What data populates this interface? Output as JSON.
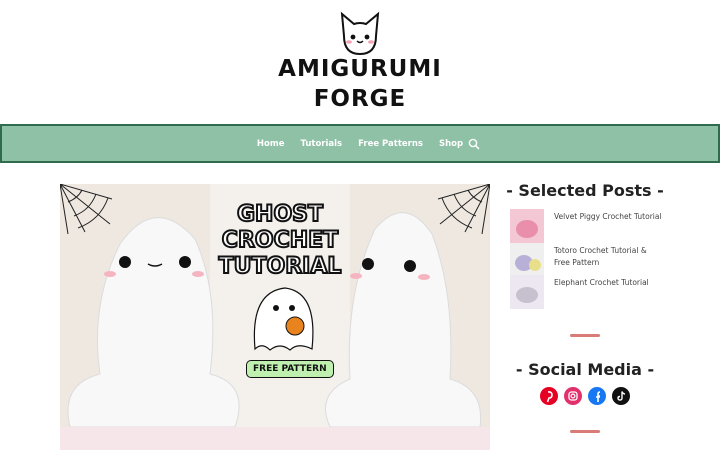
{
  "site": {
    "logo_line1": "AMIGURUMI",
    "logo_line2": "FORGE"
  },
  "nav": {
    "items": [
      "Home",
      "Tutorials",
      "Free Patterns",
      "Shop"
    ],
    "search_icon": "search-icon"
  },
  "hero": {
    "title_lines": [
      "GHOST",
      "CROCHET",
      "TUTORIAL"
    ],
    "badge": "FREE PATTERN"
  },
  "sidebar": {
    "selected_heading": "- Selected Posts -",
    "posts": [
      {
        "title": "Velvet Piggy Crochet Tutorial"
      },
      {
        "title": "Totoro Crochet Tutorial & Free Pattern"
      },
      {
        "title": "Elephant Crochet Tutorial"
      }
    ],
    "social_heading": "- Social Media -",
    "social_icons": [
      "pinterest-icon",
      "instagram-icon",
      "facebook-icon",
      "tiktok-icon"
    ]
  },
  "colors": {
    "nav_bg": "#8fc1a6",
    "nav_border": "#2f6b4f",
    "accent": "#d97b76",
    "pinterest": "#e60023",
    "instagram": "#e1306c",
    "facebook": "#1877f2",
    "tiktok": "#111111"
  }
}
